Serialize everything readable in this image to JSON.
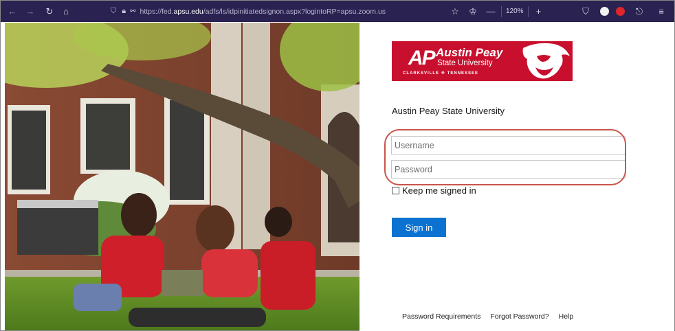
{
  "browser": {
    "url_prefix": "https://fed.",
    "url_host": "apsu.edu",
    "url_suffix": "/adfs/ls/idpinitiatedsignon.aspx?logintoRP=apsu.zoom.us",
    "zoom": "120%",
    "toolbar_color": "#2a2250"
  },
  "logo": {
    "initials": "AP",
    "line1": "Austin Peay",
    "line2": "State University",
    "line3": "CLARKSVILLE ☸ TENNESSEE",
    "brand_color": "#c8102e"
  },
  "signin": {
    "org_name": "Austin Peay State University",
    "username_placeholder": "Username",
    "password_placeholder": "Password",
    "keep_signed_in": "Keep me signed in",
    "button_label": "Sign in",
    "button_color": "#0c72d1"
  },
  "footer": {
    "links": [
      "Password Requirements",
      "Forgot Password?",
      "Help"
    ]
  }
}
